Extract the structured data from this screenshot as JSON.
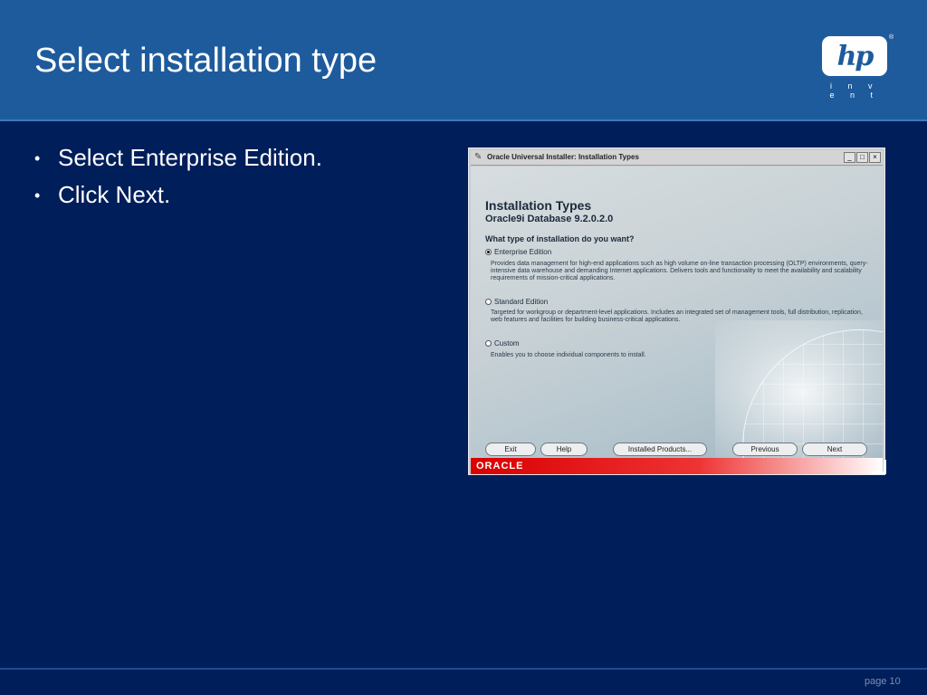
{
  "slide": {
    "title": "Select installation type",
    "bullets": [
      {
        "text": "Select Enterprise Edition."
      },
      {
        "text": "Click Next."
      }
    ],
    "page": "page 10"
  },
  "logo": {
    "badge": "hp",
    "registered": "®",
    "tagline": "i n v e n t"
  },
  "installer": {
    "window_title": "Oracle Universal Installer: Installation Types",
    "controls": [
      "_",
      "□",
      "×"
    ],
    "heading": "Installation Types",
    "subheading": "Oracle9i Database 9.2.0.2.0",
    "question": "What type of installation do you want?",
    "options": [
      {
        "label": "Enterprise Edition",
        "selected": true,
        "description": "Provides data management for high-end applications such as high volume on-line transaction processing (OLTP) environments, query-intensive data warehouse and demanding Internet applications. Delivers tools and functionality to meet the availability and scalability requirements of mission-critical applications."
      },
      {
        "label": "Standard Edition",
        "selected": false,
        "description": "Targeted for workgroup or department-level applications. Includes an integrated set of management tools, full distribution, replication, web features and facilities for building business-critical applications."
      },
      {
        "label": "Custom",
        "selected": false,
        "description": "Enables you to choose individual components to install."
      }
    ],
    "buttons": {
      "exit": "Exit",
      "help": "Help",
      "installed_products": "Installed Products...",
      "previous": "Previous",
      "next": "Next"
    },
    "footer_logo": "ORACLE"
  },
  "colors": {
    "background": "#001e5a",
    "header": "#1e5b9c",
    "oracle_red": "#d90000"
  }
}
